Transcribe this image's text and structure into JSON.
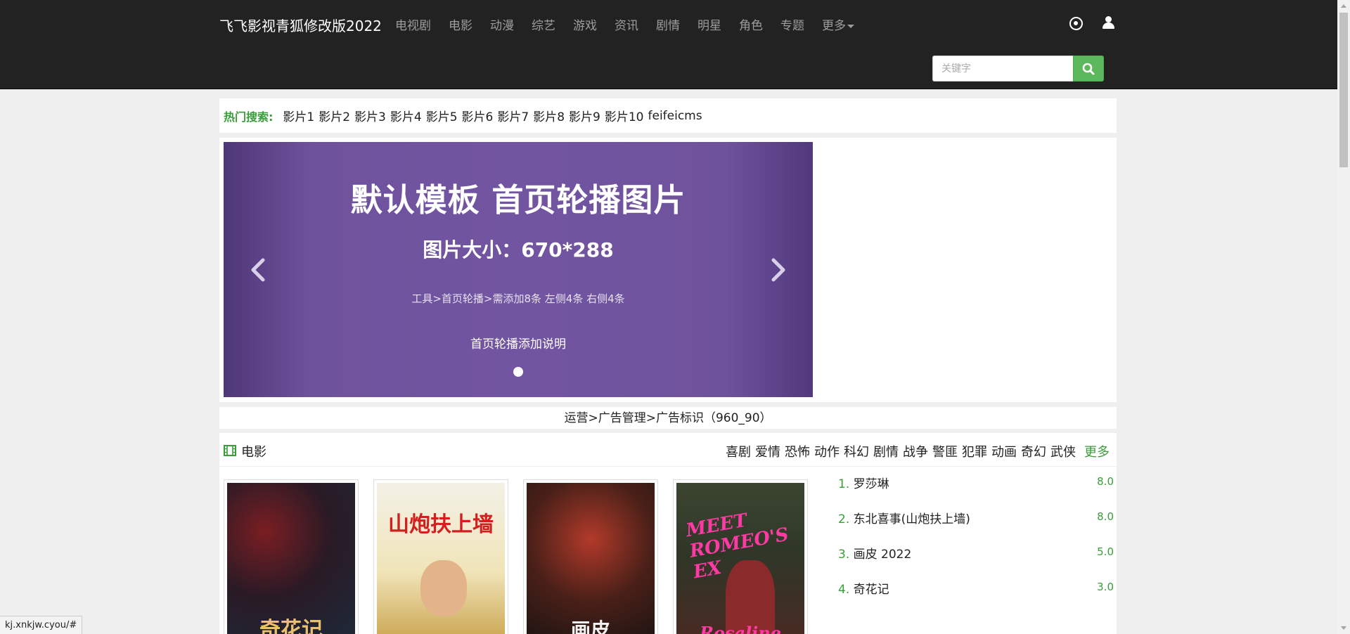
{
  "navbar": {
    "brand": "飞飞影视青狐修改版2022",
    "menu": [
      "电视剧",
      "电影",
      "动漫",
      "综艺",
      "游戏",
      "资讯",
      "剧情",
      "明星",
      "角色",
      "专题",
      "更多"
    ],
    "icons": [
      "record-icon",
      "user-icon"
    ],
    "search": {
      "placeholder": "关键字",
      "button_icon": "search-icon",
      "button_color": "#5cb85c"
    }
  },
  "hot_search": {
    "label": "热门搜索:",
    "links": [
      "影片1",
      "影片2",
      "影片3",
      "影片4",
      "影片5",
      "影片6",
      "影片7",
      "影片8",
      "影片9",
      "影片10",
      "feifeicms"
    ]
  },
  "carousel": {
    "title": "默认模板 首页轮播图片",
    "size_text": "图片大小：670*288",
    "hint": "工具>首页轮播>需添加8条  左侧4条  右侧4条",
    "caption": "首页轮播添加说明",
    "slide_color": "#7255a1"
  },
  "ad_bar": {
    "text": "运营>广告管理>广告标识（960_90）"
  },
  "movie_section": {
    "title": "电影",
    "icon": "film-icon",
    "genres": [
      "喜剧",
      "爱情",
      "恐怖",
      "动作",
      "科幻",
      "剧情",
      "战争",
      "警匪",
      "犯罪",
      "动画",
      "奇幻",
      "武侠"
    ],
    "more_label": "更多",
    "posters": [
      {
        "title": "奇花记"
      },
      {
        "title": "山炮扶上墙"
      },
      {
        "title": "画皮"
      },
      {
        "title": "MEET ROMEO'S EX",
        "subtitle": "Rosaline"
      }
    ],
    "ranking": [
      {
        "num": "1.",
        "name": "罗莎琳",
        "score": "8.0"
      },
      {
        "num": "2.",
        "name": "东北喜事(山炮扶上墙)",
        "score": "8.0"
      },
      {
        "num": "3.",
        "name": "画皮 2022",
        "score": "5.0"
      },
      {
        "num": "4.",
        "name": "奇花记",
        "score": "3.0"
      }
    ]
  },
  "status_bar": {
    "url": "kj.xnkjw.cyou/#"
  },
  "colors": {
    "navbar_bg": "#222222",
    "accent_green": "#3a9d3a",
    "page_bg": "#efefef"
  }
}
